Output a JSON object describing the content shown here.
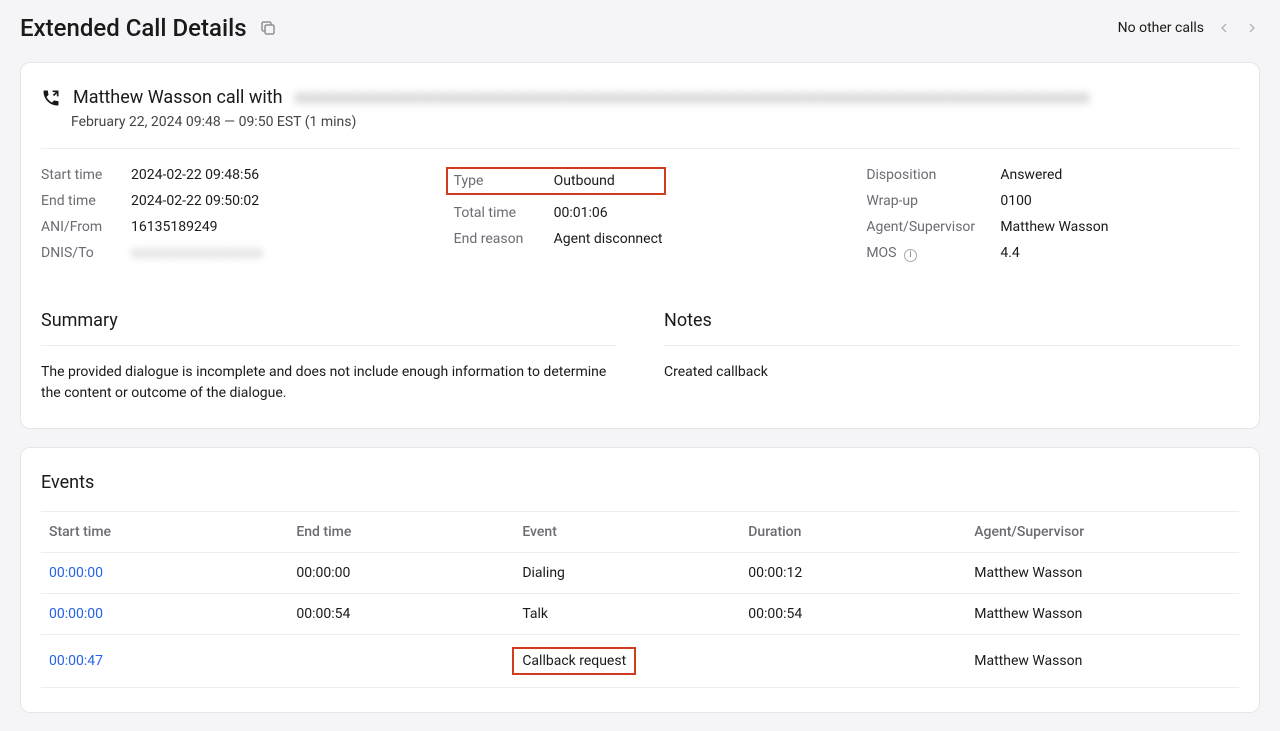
{
  "header": {
    "title": "Extended Call Details",
    "pager_label": "No other calls"
  },
  "call": {
    "title_prefix": "Matthew Wasson call with",
    "title_redacted": "xxxxxxxxxxxxxxxxxxxxxxxxxxxxxxxxxxxxxxxxxxxxxxxxxxxxxxxxxxxxxxxxxxxxxxxxxxxxxxxxxxxxxxxxx",
    "subtitle": "February 22, 2024   09:48 — 09:50 EST (1 mins)"
  },
  "meta": {
    "labels": {
      "start_time": "Start time",
      "end_time": "End time",
      "ani_from": "ANI/From",
      "dnis_to": "DNIS/To",
      "type": "Type",
      "total_time": "Total time",
      "end_reason": "End reason",
      "disposition": "Disposition",
      "wrap_up": "Wrap-up",
      "agent_supervisor": "Agent/Supervisor",
      "mos": "MOS"
    },
    "values": {
      "start_time": "2024-02-22   09:48:56",
      "end_time": "2024-02-22   09:50:02",
      "ani_from": "16135189249",
      "dnis_to_redacted": "xxxxxxxxxxxxxxxxxxx",
      "type": "Outbound",
      "total_time": "00:01:06",
      "end_reason": "Agent disconnect",
      "disposition": "Answered",
      "wrap_up": "0100",
      "agent_supervisor": "Matthew Wasson",
      "mos": "4.4"
    }
  },
  "summary": {
    "title": "Summary",
    "body": "The provided dialogue is incomplete and does not include enough information to determine the content or outcome of the dialogue."
  },
  "notes": {
    "title": "Notes",
    "body": "Created callback"
  },
  "events": {
    "title": "Events",
    "headers": {
      "start_time": "Start time",
      "end_time": "End time",
      "event": "Event",
      "duration": "Duration",
      "agent_supervisor": "Agent/Supervisor"
    },
    "rows": [
      {
        "start_time": "00:00:00",
        "end_time": "00:00:00",
        "event": "Dialing",
        "duration": "00:00:12",
        "agent": "Matthew Wasson",
        "highlight": false
      },
      {
        "start_time": "00:00:00",
        "end_time": "00:00:54",
        "event": "Talk",
        "duration": "00:00:54",
        "agent": "Matthew Wasson",
        "highlight": false
      },
      {
        "start_time": "00:00:47",
        "end_time": "",
        "event": "Callback request",
        "duration": "",
        "agent": "Matthew Wasson",
        "highlight": true
      }
    ]
  }
}
